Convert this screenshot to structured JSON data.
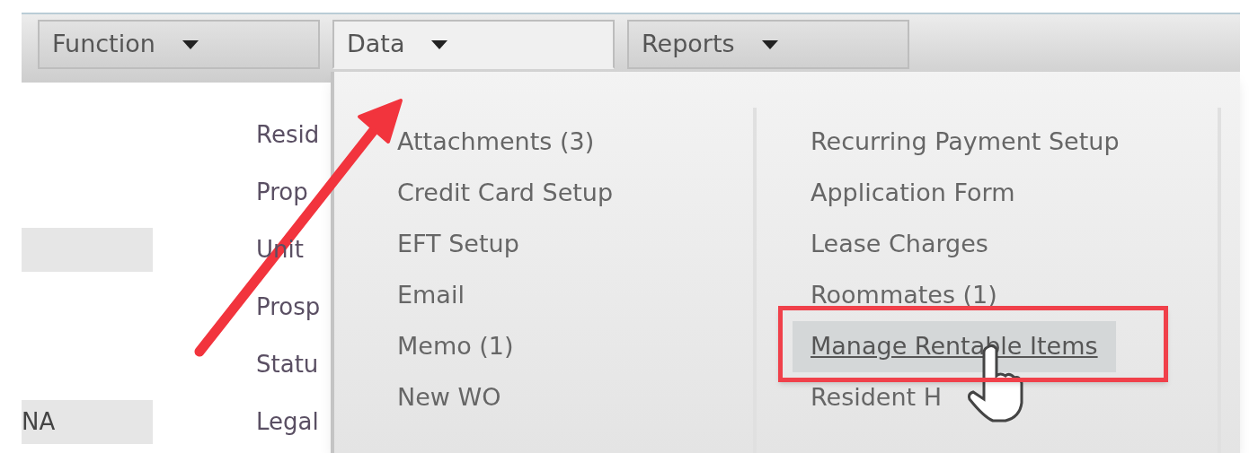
{
  "toolbar": {
    "menus": [
      {
        "label": "Function",
        "selected": false
      },
      {
        "label": "Data",
        "selected": true
      },
      {
        "label": "Reports",
        "selected": false
      }
    ]
  },
  "form": {
    "rows": [
      {
        "label": "Resid",
        "field": false
      },
      {
        "label": "Prop",
        "field": false
      },
      {
        "label": "Unit",
        "field": true
      },
      {
        "label": "Prosp",
        "field": false
      },
      {
        "label": "Statu",
        "field": false
      },
      {
        "label": "Legal",
        "field": true,
        "value": "NA"
      }
    ]
  },
  "dropdown": {
    "columns": [
      [
        {
          "label": "Attachments (3)",
          "highlighted": false
        },
        {
          "label": "Credit Card Setup",
          "highlighted": false
        },
        {
          "label": "EFT Setup",
          "highlighted": false
        },
        {
          "label": "Email",
          "highlighted": false
        },
        {
          "label": "Memo (1)",
          "highlighted": false
        },
        {
          "label": "New WO",
          "highlighted": false
        }
      ],
      [
        {
          "label": "Recurring Payment Setup",
          "highlighted": false
        },
        {
          "label": "Application Form",
          "highlighted": false
        },
        {
          "label": "Lease Charges",
          "highlighted": false
        },
        {
          "label": "Roommates (1)",
          "highlighted": false
        },
        {
          "label": "Manage Rentable Items",
          "highlighted": true
        },
        {
          "label": "Resident H",
          "highlighted": false
        }
      ]
    ]
  }
}
